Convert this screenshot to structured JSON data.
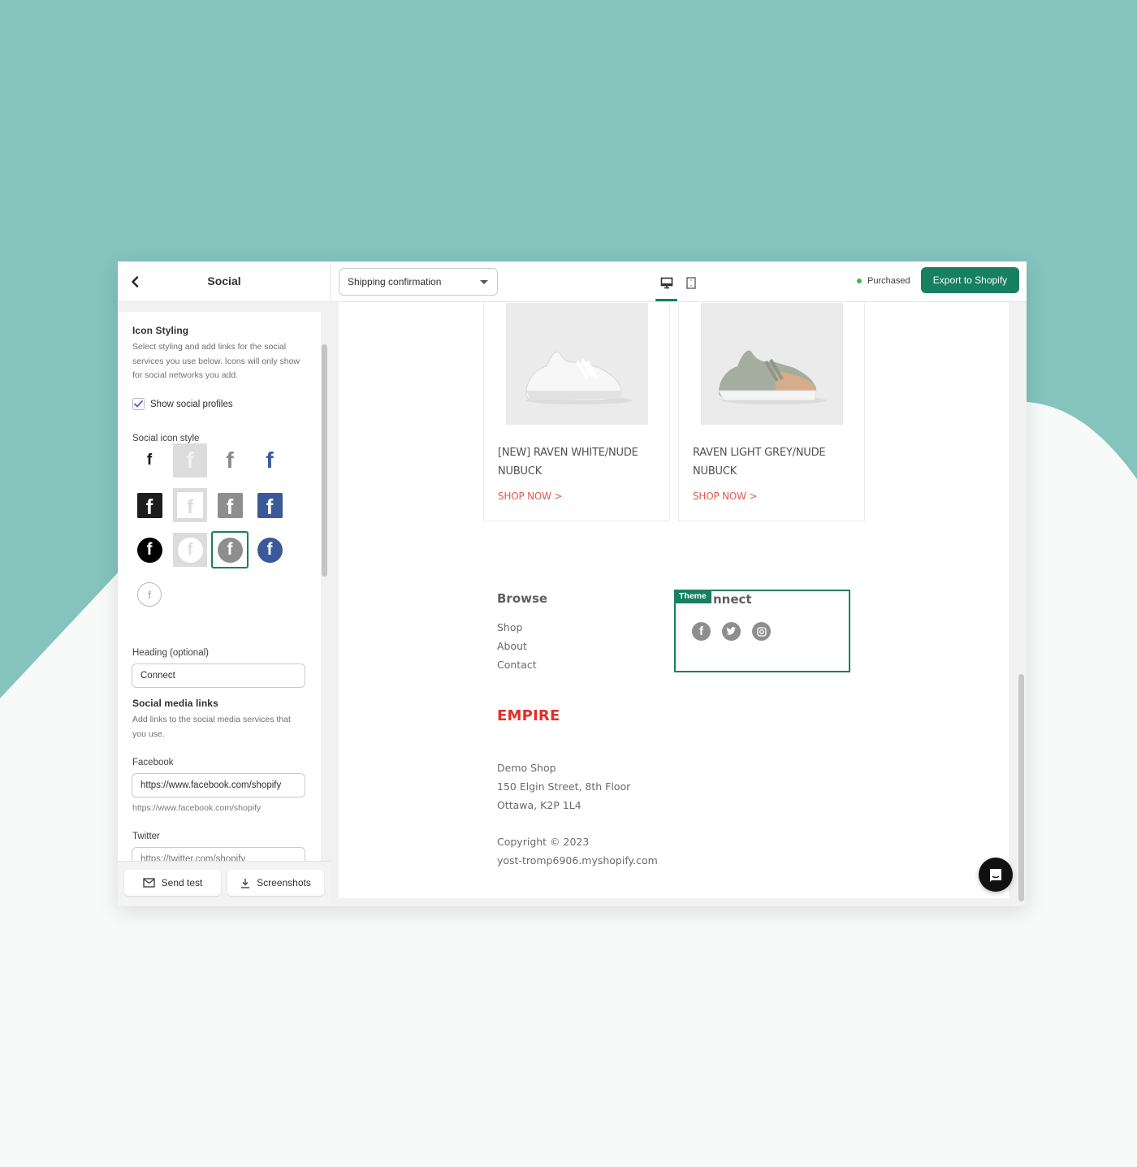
{
  "colors": {
    "background_teal": "#84c4bd",
    "background_light": "#f8faf9",
    "accent": "#168060",
    "link_red": "#e05a4f",
    "brand_red": "#e0302a",
    "facebook_blue": "#3b5998",
    "status_green": "#3fb950"
  },
  "left_panel": {
    "back_icon": "chevron-left-icon",
    "title": "Social",
    "icon_styling": {
      "title": "Icon Styling",
      "description": "Select styling and add links for the social services you use below. Icons will only show for social networks you add.",
      "show_profiles_label": "Show social profiles",
      "show_profiles_checked": true
    },
    "social_icon_style": {
      "label": "Social icon style",
      "options": [
        {
          "name": "plain-black",
          "glyph": "f"
        },
        {
          "name": "plain-light-box",
          "glyph": "f"
        },
        {
          "name": "plain-grey",
          "glyph": "f"
        },
        {
          "name": "plain-blue",
          "glyph": "f"
        },
        {
          "name": "square-black",
          "glyph": "f"
        },
        {
          "name": "square-white-outline",
          "glyph": "f"
        },
        {
          "name": "square-grey",
          "glyph": "f"
        },
        {
          "name": "square-blue",
          "glyph": "f"
        },
        {
          "name": "circle-black",
          "glyph": "f"
        },
        {
          "name": "circle-white",
          "glyph": "f"
        },
        {
          "name": "circle-grey",
          "glyph": "f"
        },
        {
          "name": "circle-blue",
          "glyph": "f"
        },
        {
          "name": "circle-outline",
          "glyph": "f"
        }
      ],
      "selected": "circle-grey"
    },
    "heading": {
      "label": "Heading (optional)",
      "value": "Connect"
    },
    "social_links": {
      "title": "Social media links",
      "description": "Add links to the social media services that you use."
    },
    "facebook": {
      "label": "Facebook",
      "value": "https://www.facebook.com/shopify",
      "help": "https://www.facebook.com/shopify"
    },
    "twitter": {
      "label": "Twitter",
      "value": "https://twitter.com/shopify"
    },
    "footer": {
      "send_test": "Send test",
      "screenshots": "Screenshots"
    }
  },
  "topbar": {
    "template_select": "Shipping confirmation",
    "views": [
      "desktop",
      "mobile"
    ],
    "active_view": "desktop",
    "status": "Purchased",
    "export_label": "Export to Shopify"
  },
  "preview": {
    "products": [
      {
        "name": "[NEW] RAVEN WHITE/NUDE NUBUCK",
        "cta": "SHOP NOW >"
      },
      {
        "name": "RAVEN LIGHT GREY/NUDE NUBUCK",
        "cta": "SHOP NOW >"
      }
    ],
    "browse": {
      "title": "Browse",
      "links": [
        "Shop",
        "About",
        "Contact"
      ]
    },
    "connect": {
      "tag": "Theme",
      "title": "Connect",
      "title_visible": "nnect",
      "icons": [
        "facebook-icon",
        "twitter-icon",
        "instagram-icon"
      ]
    },
    "brand": "EMPIRE",
    "address": [
      "Demo Shop",
      "150 Elgin Street, 8th Floor",
      "Ottawa, K2P 1L4"
    ],
    "copyright": "Copyright © 2023",
    "domain": "yost-tromp6906.myshopify.com",
    "chat_icon": "chat-bubble-icon"
  }
}
